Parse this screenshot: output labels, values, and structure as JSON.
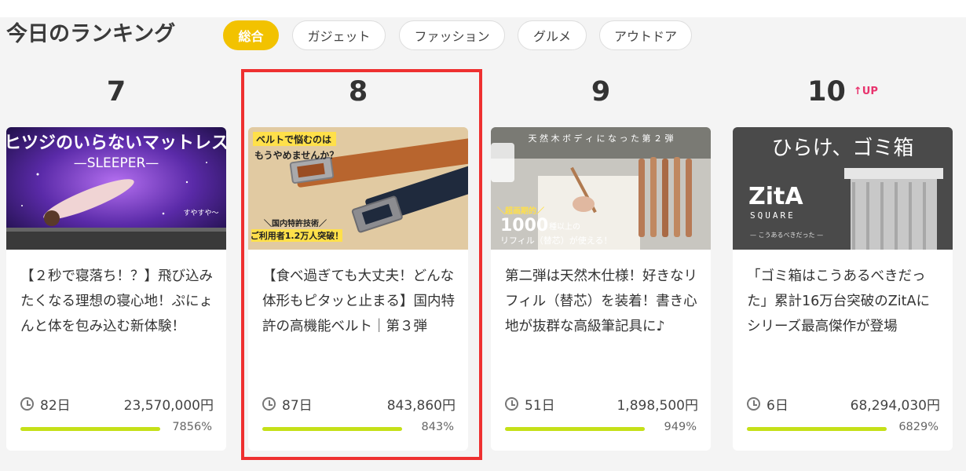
{
  "heading": "今日のランキング",
  "tabs": [
    "総合",
    "ガジェット",
    "ファッション",
    "グルメ",
    "アウトドア"
  ],
  "active_tab": "総合",
  "cards": [
    {
      "rank": "7",
      "badge": "",
      "image_text": {
        "line1": "ヒツジのいらないマットレス",
        "line2": "—SLEEPER—",
        "line3": "すやすや〜"
      },
      "title": "【２秒で寝落ち！？】飛び込みたくなる理想の寝心地！ぷにょんと体を包み込む新体験！",
      "days": "82日",
      "amount": "23,570,000円",
      "progress_percent": 7856,
      "percent_label": "7856%"
    },
    {
      "rank": "8",
      "badge": "",
      "image_text": {
        "line1": "ベルトで悩むのは",
        "line2": "もうやめませんか？",
        "line3": "＼国内特許技術／",
        "line4": "ご利用者1.2万人突破！"
      },
      "title": "【食べ過ぎても大丈夫！どんな体形もピタッと止まる】国内特許の高機能ベルト｜第３弾",
      "days": "87日",
      "amount": "843,860円",
      "progress_percent": 843,
      "percent_label": "843%"
    },
    {
      "rank": "9",
      "badge": "",
      "image_text": {
        "line1": "天 然 木 ボ デ ィ に な っ た 第 ２ 弾",
        "line2": "＼超画期的／",
        "line3": "1000",
        "line4": "種以上の",
        "line5": "リフィル（替芯）が使える！"
      },
      "title": "第二弾は天然木仕様！好きなリフィル（替芯）を装着！書き心地が抜群な高級筆記具に♪",
      "days": "51日",
      "amount": "1,898,500円",
      "progress_percent": 949,
      "percent_label": "949%"
    },
    {
      "rank": "10",
      "badge": "UP",
      "image_text": {
        "line1": "ひらけ、ゴミ箱",
        "line2": "ZitA",
        "line3": "SQUARE",
        "line4": "— こうあるべきだった —"
      },
      "title": "「ゴミ箱はこうあるべきだった」累計16万台突破のZitAにシリーズ最高傑作が登場",
      "days": "6日",
      "amount": "68,294,030円",
      "progress_percent": 6829,
      "percent_label": "6829%"
    }
  ],
  "colors": {
    "active_tab": "#f2c200",
    "progress": "#c5e018",
    "up_badge": "#e8336d",
    "highlight": "#ee3030"
  }
}
